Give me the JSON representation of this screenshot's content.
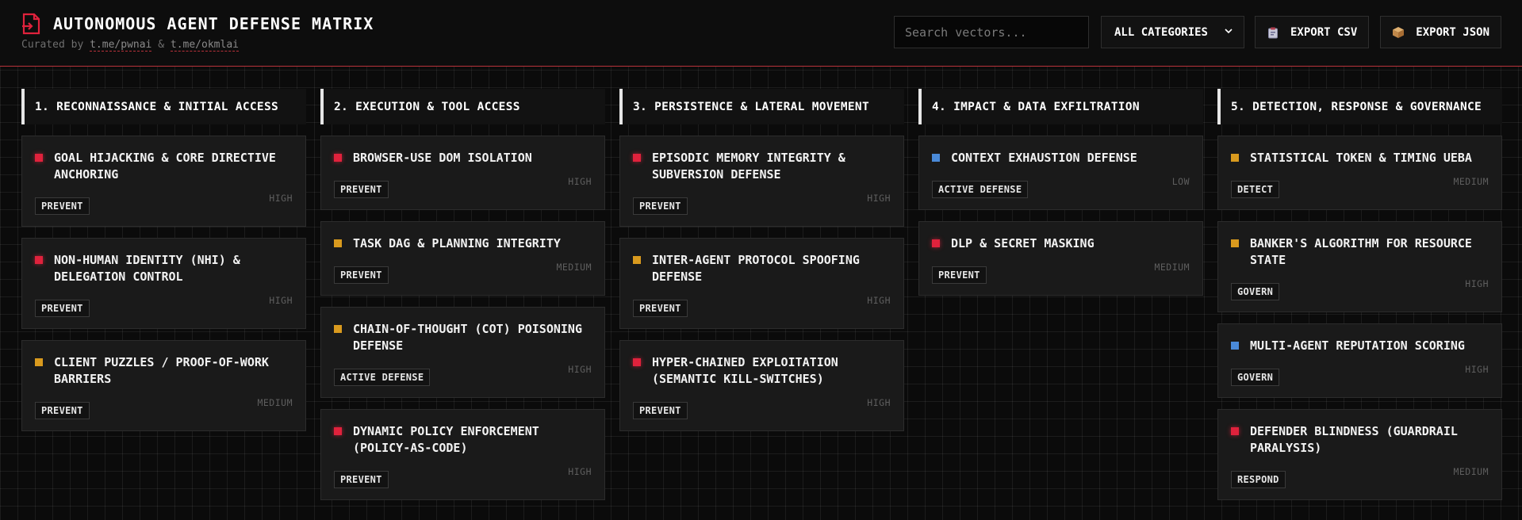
{
  "header": {
    "title": "AUTONOMOUS AGENT DEFENSE MATRIX",
    "subtitle_prefix": "Curated by",
    "link1": "t.me/pwnai",
    "amp": "&",
    "link2": "t.me/okmlai",
    "logo_icon": "exit-door-icon",
    "accent_color": "#e0223c"
  },
  "controls": {
    "search_placeholder": "Search vectors...",
    "category_select": "ALL CATEGORIES",
    "export_csv": "EXPORT CSV",
    "export_json": "EXPORT JSON"
  },
  "severity_colors": {
    "high": "#e0223c",
    "medium": "#d99a1e",
    "low": "#4a8ad8"
  },
  "columns": [
    {
      "title": "1. RECONNAISSANCE & INITIAL ACCESS",
      "cards": [
        {
          "name": "GOAL HIJACKING & CORE DIRECTIVE ANCHORING",
          "tag": "PREVENT",
          "severity": "HIGH",
          "level": "high"
        },
        {
          "name": "NON-HUMAN IDENTITY (NHI) & DELEGATION CONTROL",
          "tag": "PREVENT",
          "severity": "HIGH",
          "level": "high"
        },
        {
          "name": "CLIENT PUZZLES / PROOF-OF-WORK BARRIERS",
          "tag": "PREVENT",
          "severity": "MEDIUM",
          "level": "medium"
        }
      ]
    },
    {
      "title": "2. EXECUTION & TOOL ACCESS",
      "cards": [
        {
          "name": "BROWSER-USE DOM ISOLATION",
          "tag": "PREVENT",
          "severity": "HIGH",
          "level": "high"
        },
        {
          "name": "TASK DAG & PLANNING INTEGRITY",
          "tag": "PREVENT",
          "severity": "MEDIUM",
          "level": "medium"
        },
        {
          "name": "CHAIN-OF-THOUGHT (COT) POISONING DEFENSE",
          "tag": "ACTIVE DEFENSE",
          "severity": "HIGH",
          "level": "medium"
        },
        {
          "name": "DYNAMIC POLICY ENFORCEMENT (POLICY-AS-CODE)",
          "tag": "PREVENT",
          "severity": "HIGH",
          "level": "high"
        }
      ]
    },
    {
      "title": "3. PERSISTENCE & LATERAL MOVEMENT",
      "cards": [
        {
          "name": "EPISODIC MEMORY INTEGRITY & SUBVERSION DEFENSE",
          "tag": "PREVENT",
          "severity": "HIGH",
          "level": "high"
        },
        {
          "name": "INTER-AGENT PROTOCOL SPOOFING DEFENSE",
          "tag": "PREVENT",
          "severity": "HIGH",
          "level": "medium"
        },
        {
          "name": "HYPER-CHAINED EXPLOITATION (SEMANTIC KILL-SWITCHES)",
          "tag": "PREVENT",
          "severity": "HIGH",
          "level": "high"
        }
      ]
    },
    {
      "title": "4. IMPACT & DATA EXFILTRATION",
      "cards": [
        {
          "name": "CONTEXT EXHAUSTION DEFENSE",
          "tag": "ACTIVE DEFENSE",
          "severity": "LOW",
          "level": "low"
        },
        {
          "name": "DLP & SECRET MASKING",
          "tag": "PREVENT",
          "severity": "MEDIUM",
          "level": "high"
        }
      ]
    },
    {
      "title": "5. DETECTION, RESPONSE & GOVERNANCE",
      "cards": [
        {
          "name": "STATISTICAL TOKEN & TIMING UEBA",
          "tag": "DETECT",
          "severity": "MEDIUM",
          "level": "medium"
        },
        {
          "name": "BANKER'S ALGORITHM FOR RESOURCE STATE",
          "tag": "GOVERN",
          "severity": "HIGH",
          "level": "medium"
        },
        {
          "name": "MULTI-AGENT REPUTATION SCORING",
          "tag": "GOVERN",
          "severity": "HIGH",
          "level": "low"
        },
        {
          "name": "DEFENDER BLINDNESS (GUARDRAIL PARALYSIS)",
          "tag": "RESPOND",
          "severity": "MEDIUM",
          "level": "high"
        }
      ]
    }
  ]
}
